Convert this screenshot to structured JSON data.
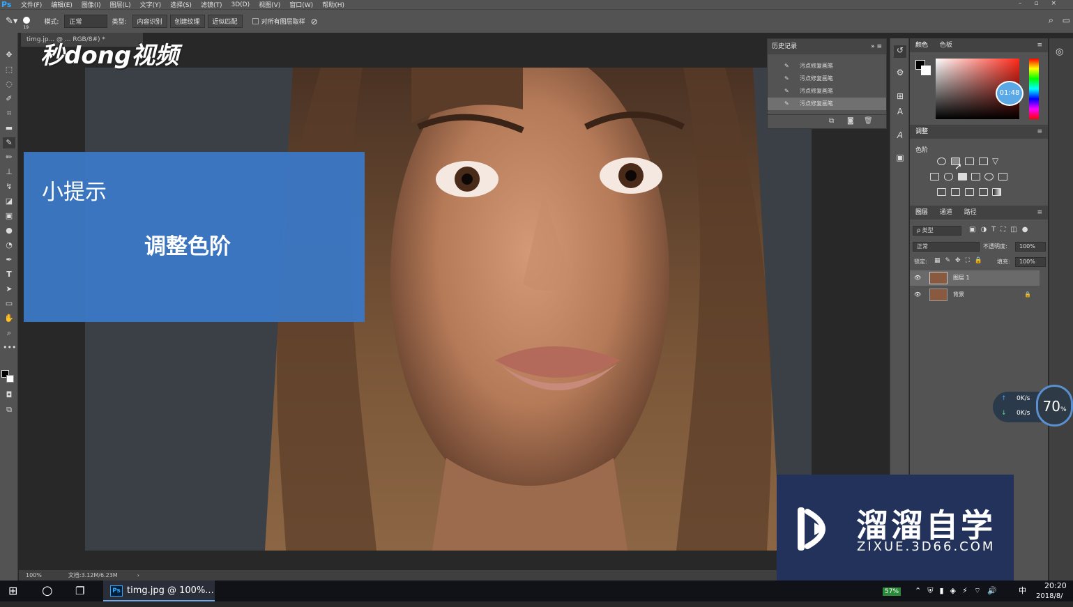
{
  "menubar": {
    "logo": "Ps",
    "items": [
      "文件(F)",
      "编辑(E)",
      "图像(I)",
      "图层(L)",
      "文字(Y)",
      "选择(S)",
      "滤镜(T)",
      "3D(D)",
      "视图(V)",
      "窗口(W)",
      "帮助(H)"
    ],
    "window_controls": "–▫×"
  },
  "options": {
    "brush_size": "19",
    "mode_label": "模式:",
    "mode_value": "正常",
    "type_label": "类型:",
    "type_buttons": [
      "内容识别",
      "创建纹理",
      "近似匹配"
    ],
    "sample_all_label": "对所有图层取样"
  },
  "document": {
    "tab_title": "timg.jp... @ ... RGB/8#) *",
    "zoom": "100%",
    "doc_size": "文档:3.12M/6.23M"
  },
  "watermark_top": "秒dong视频",
  "tip": {
    "title": "小提示",
    "subtitle": "调整色阶"
  },
  "history": {
    "title": "历史记录",
    "rows": [
      "污点修复画笔",
      "污点修复画笔",
      "污点修复画笔",
      "污点修复画笔"
    ]
  },
  "color_panel": {
    "tabs": [
      "颜色",
      "色板"
    ],
    "time_badge": "01:48"
  },
  "adjust_panel": {
    "title": "调整",
    "subtitle": "色阶"
  },
  "layers_panel": {
    "tabs": [
      "图层",
      "通道",
      "路径"
    ],
    "filter": "ρ 类型",
    "blend_mode": "正常",
    "opacity_label": "不透明度:",
    "opacity_value": "100%",
    "lock_label": "锁定:",
    "fill_label": "填充:",
    "fill_value": "100%",
    "layers": [
      {
        "name": "图层 1",
        "selected": true
      },
      {
        "name": "背景",
        "selected": false
      }
    ]
  },
  "speed_widget": {
    "up": "0K/s",
    "down": "0K/s",
    "percent": "70",
    "percent_unit": "%"
  },
  "zixue": {
    "cn": "溜溜自学",
    "en": "ZIXUE.3D66.COM"
  },
  "taskbar": {
    "ps_label": "timg.jpg @ 100%...",
    "battery": "57%",
    "ime": "中",
    "time": "20:20",
    "date": "2018/8/"
  },
  "colors": {
    "panel": "#535353",
    "canvas_bg": "#3b4046",
    "tip_blue": "#3b78c4",
    "accent": "#31a8ff"
  }
}
